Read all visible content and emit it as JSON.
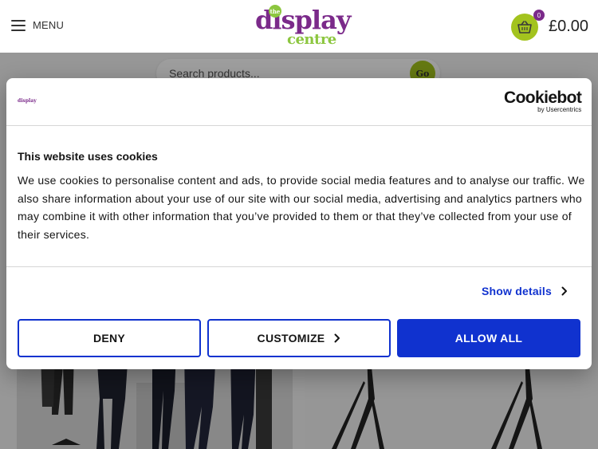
{
  "header": {
    "menu_label": "MENU",
    "logo": {
      "the": "the",
      "word1": "display",
      "word2": "centre"
    },
    "basket_count": "0",
    "basket_total": "£0.00"
  },
  "search": {
    "placeholder": "Search products...",
    "go_label": "Go"
  },
  "cookie_dialog": {
    "mini_logo": "display",
    "provider_name": "Cookiebot",
    "provider_sub": "by Usercentrics",
    "title": "This website uses cookies",
    "body": "We use cookies to personalise content and ads, to provide social media features and to analyse our traffic. We also share information about your use of our site with our social media, advertising and analytics partners who may combine it with other information that you’ve provided to them or that they’ve collected from your use of their services.",
    "show_details_label": "Show details",
    "buttons": {
      "deny": "DENY",
      "customize": "CUSTOMIZE",
      "allow_all": "ALLOW ALL"
    }
  },
  "colors": {
    "brand_purple": "#7b2a8a",
    "brand_green": "#a3c31e",
    "cookiebot_blue": "#1032cf"
  },
  "icons": [
    "hamburger-icon",
    "basket-icon",
    "chevron-right-icon"
  ]
}
